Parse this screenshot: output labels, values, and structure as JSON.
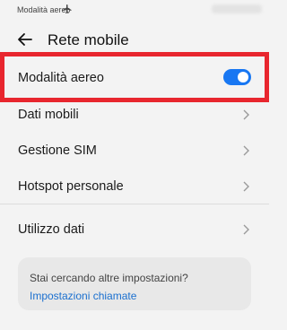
{
  "status_bar": {
    "text": "Modalità aereo",
    "icon": "airplane-icon"
  },
  "header": {
    "title": "Rete mobile",
    "back_icon": "arrow-left-icon"
  },
  "airplane_mode": {
    "label": "Modalità aereo",
    "enabled": true,
    "highlight_color": "#e8262e",
    "accent_color": "#1877f2"
  },
  "items": [
    {
      "label": "Dati mobili"
    },
    {
      "label": "Gestione SIM"
    },
    {
      "label": "Hotspot personale"
    }
  ],
  "data_usage": {
    "label": "Utilizzo dati"
  },
  "suggestion_card": {
    "text": "Stai cercando altre impostazioni?",
    "link": "Impostazioni chiamate",
    "link_color": "#1a6fcf"
  }
}
